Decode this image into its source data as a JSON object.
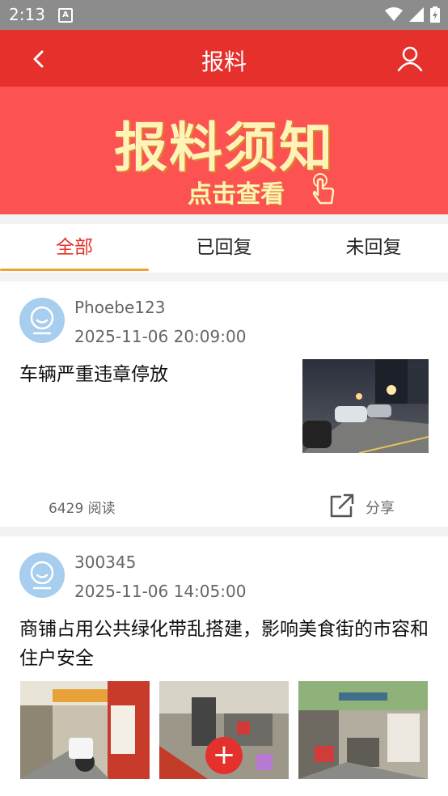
{
  "status_bar": {
    "time": "2:13",
    "notif_icon": "A"
  },
  "app_bar": {
    "title": "报料"
  },
  "banner": {
    "heading": "报料须知",
    "subheading": "点击查看"
  },
  "tabs": [
    {
      "label": "全部",
      "active": true
    },
    {
      "label": "已回复",
      "active": false
    },
    {
      "label": "未回复",
      "active": false
    }
  ],
  "posts": [
    {
      "username": "Phoebe123",
      "datetime": "2025-11-06 20:09:00",
      "content": "车辆严重违章停放",
      "reads": "6429 阅读",
      "share_label": "分享"
    },
    {
      "username": "300345",
      "datetime": "2025-11-06 14:05:00",
      "content": "商铺占用公共绿化带乱搭建，影响美食街的市容和住户安全"
    }
  ],
  "fab_symbol": "+",
  "colors": {
    "primary_red": "#e5302c",
    "banner_red": "#fd5252",
    "tab_indicator": "#f0a030",
    "avatar_blue": "#a7cdef"
  }
}
